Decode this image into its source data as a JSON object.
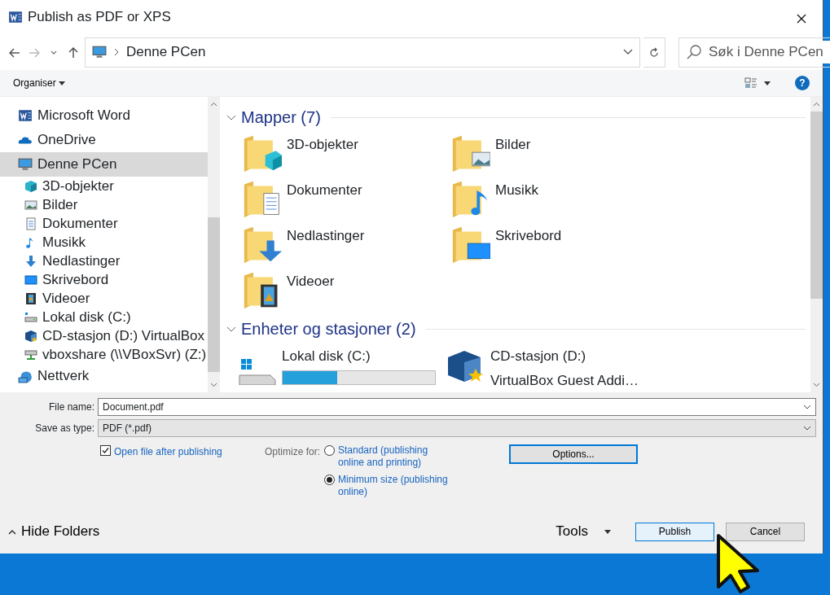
{
  "window": {
    "title": "Publish as PDF or XPS"
  },
  "address": {
    "path": "Denne PCen"
  },
  "search": {
    "placeholder": "Søk i Denne PCen"
  },
  "toolbar": {
    "organise": "Organiser",
    "help": "?"
  },
  "sidebar": {
    "items": [
      {
        "label": "Microsoft Word",
        "kind": "word",
        "selected": false
      },
      {
        "label": "OneDrive",
        "kind": "onedrive",
        "selected": false
      },
      {
        "label": "Denne PCen",
        "kind": "pc",
        "selected": true,
        "children": [
          {
            "label": "3D-objekter",
            "kind": "cube",
            "selected": false
          },
          {
            "label": "Bilder",
            "kind": "pictures",
            "selected": false
          },
          {
            "label": "Dokumenter",
            "kind": "documents",
            "selected": false
          },
          {
            "label": "Musikk",
            "kind": "music",
            "selected": false
          },
          {
            "label": "Nedlastinger",
            "kind": "downloads",
            "selected": false
          },
          {
            "label": "Skrivebord",
            "kind": "desktop",
            "selected": false
          },
          {
            "label": "Videoer",
            "kind": "videos",
            "selected": false
          },
          {
            "label": "Lokal disk (C:)",
            "kind": "disk",
            "selected": false
          },
          {
            "label": "CD-stasjon (D:) VirtualBox",
            "kind": "cd",
            "selected": false
          },
          {
            "label": "vboxshare (\\\\VBoxSvr) (Z:)",
            "kind": "netdrive",
            "selected": false
          }
        ]
      },
      {
        "label": "Nettverk",
        "kind": "network",
        "selected": false
      }
    ]
  },
  "content": {
    "groups": [
      {
        "title": "Mapper (7)",
        "expanded": true,
        "items": [
          {
            "label": "3D-objekter",
            "kind": "cube"
          },
          {
            "label": "Bilder",
            "kind": "pictures"
          },
          {
            "label": "Dokumenter",
            "kind": "documents"
          },
          {
            "label": "Musikk",
            "kind": "music"
          },
          {
            "label": "Nedlastinger",
            "kind": "downloads"
          },
          {
            "label": "Skrivebord",
            "kind": "desktop"
          },
          {
            "label": "Videoer",
            "kind": "videos"
          }
        ]
      },
      {
        "title": "Enheter og stasjoner (2)",
        "expanded": true,
        "items": [
          {
            "label": "Lokal disk (C:)",
            "kind": "disk",
            "level": 0.36
          },
          {
            "label": "CD-stasjon (D:)",
            "kind": "cd",
            "sublabel": "VirtualBox Guest Addi…"
          }
        ]
      }
    ]
  },
  "form": {
    "file_name": {
      "label": "File name:",
      "value": "Document.pdf"
    },
    "save_type": {
      "label": "Save as type:",
      "value": "PDF (*.pdf)"
    },
    "open_after": {
      "label": "Open file after publishing",
      "checked": true
    },
    "optimize": {
      "label": "Optimize for:",
      "options": [
        {
          "label": "Standard (publishing online and printing)",
          "selected": false
        },
        {
          "label": "Minimum size (publishing online)",
          "selected": true
        }
      ]
    },
    "options_button": "Options..."
  },
  "footer": {
    "hide_folders": "Hide Folders",
    "tools": "Tools",
    "buttons": [
      {
        "label": "Publish",
        "kind": "primary"
      },
      {
        "label": "Cancel",
        "kind": "default"
      }
    ]
  }
}
